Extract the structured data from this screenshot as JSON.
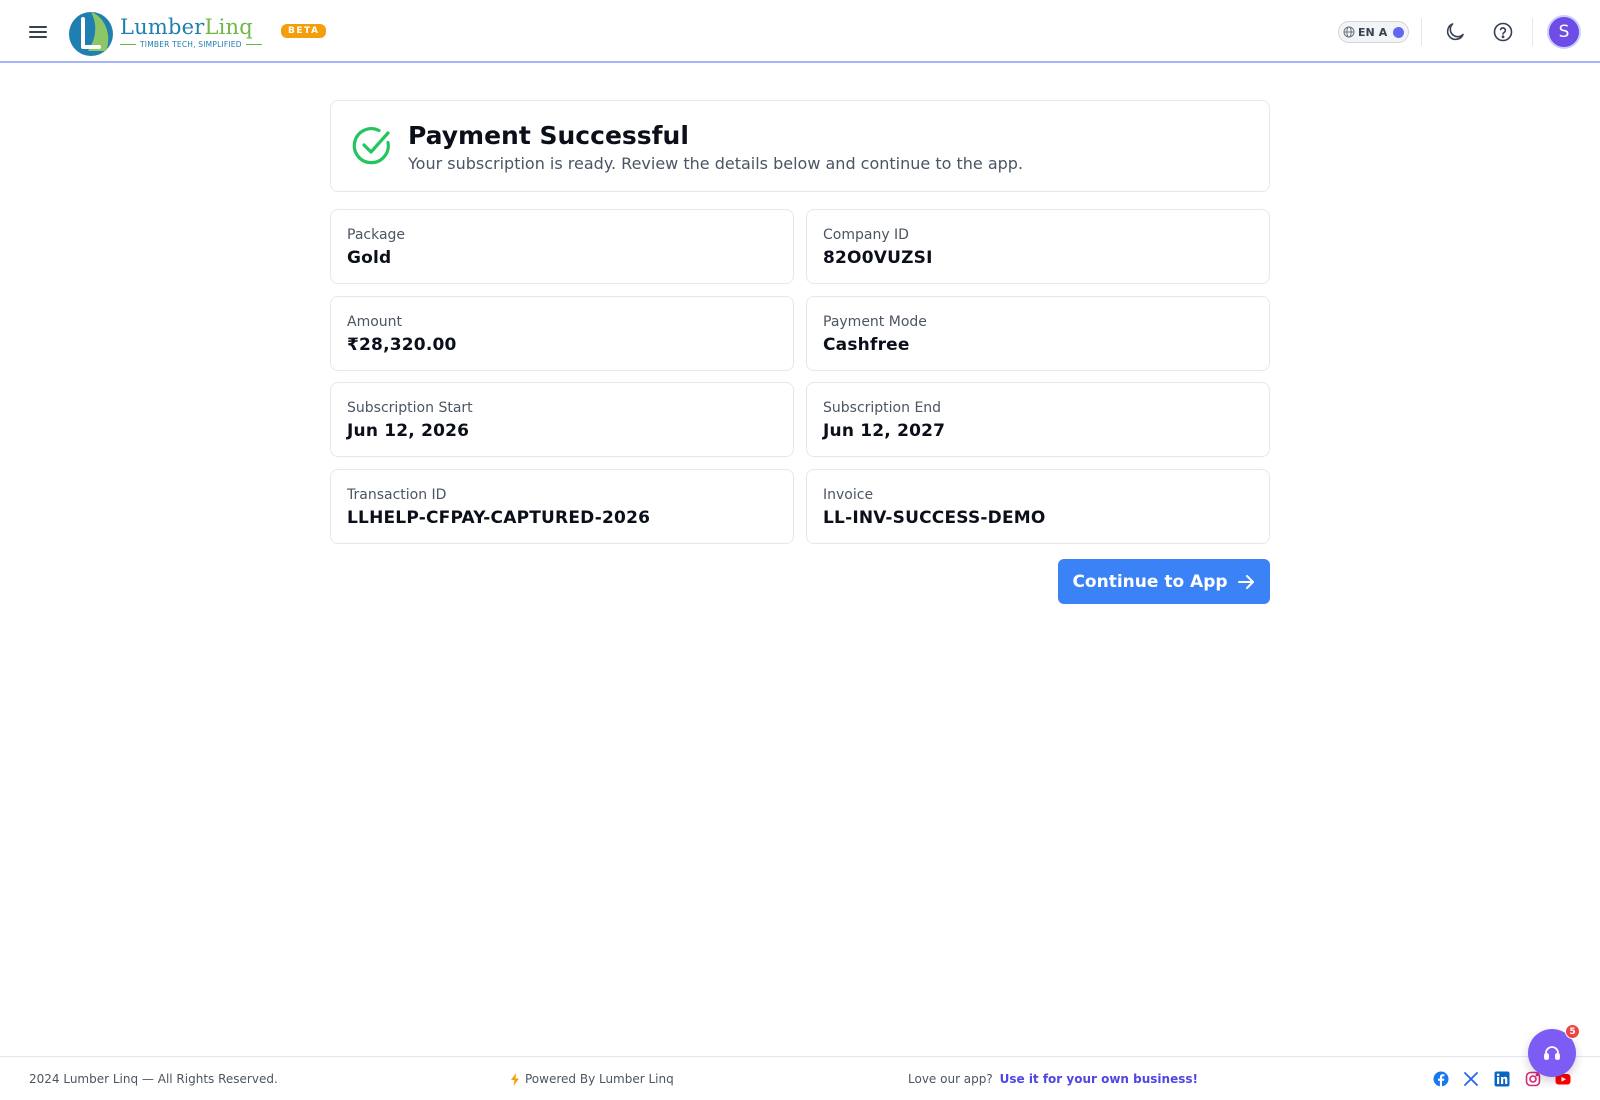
{
  "header": {
    "brand_name_part1": "Lumber",
    "brand_name_part2": "Linq",
    "brand_tagline": "TIMBER TECH, SIMPLIFIED",
    "beta_label": "BETA",
    "language_code": "EN",
    "language_alt": "A",
    "avatar_initial": "S"
  },
  "banner": {
    "title": "Payment Successful",
    "subtitle": "Your subscription is ready. Review the details below and continue to the app."
  },
  "details": {
    "package": {
      "label": "Package",
      "value": "Gold"
    },
    "company_id": {
      "label": "Company ID",
      "value": "82O0VUZSI"
    },
    "amount": {
      "label": "Amount",
      "value": "₹28,320.00"
    },
    "payment_mode": {
      "label": "Payment Mode",
      "value": "Cashfree"
    },
    "subscription_start": {
      "label": "Subscription Start",
      "value": "Jun 12, 2026"
    },
    "subscription_end": {
      "label": "Subscription End",
      "value": "Jun 12, 2027"
    },
    "transaction_id": {
      "label": "Transaction ID",
      "value": "LLHELP-CFPAY-CAPTURED-2026"
    },
    "invoice": {
      "label": "Invoice",
      "value": "LL-INV-SUCCESS-DEMO"
    }
  },
  "continue_label": "Continue to App",
  "footer": {
    "copyright": "2024 Lumber Linq — All Rights Reserved.",
    "powered_by": "Powered By Lumber Linq",
    "love_text": "Love our app?",
    "love_link": "Use it for your own business!"
  },
  "support": {
    "badge_count": "5"
  },
  "colors": {
    "primary_button": "#3b82f6",
    "success_check": "#22c55e",
    "beta_badge": "#f59e0b",
    "avatar": "#6d4de6",
    "support_button": "#7c5cf5",
    "link": "#4f46e5"
  },
  "icons": {
    "menu": "hamburger-icon",
    "theme": "moon-icon",
    "help": "help-circle-icon",
    "success": "check-circle-icon",
    "continue": "arrow-right-icon",
    "support": "headset-icon"
  }
}
